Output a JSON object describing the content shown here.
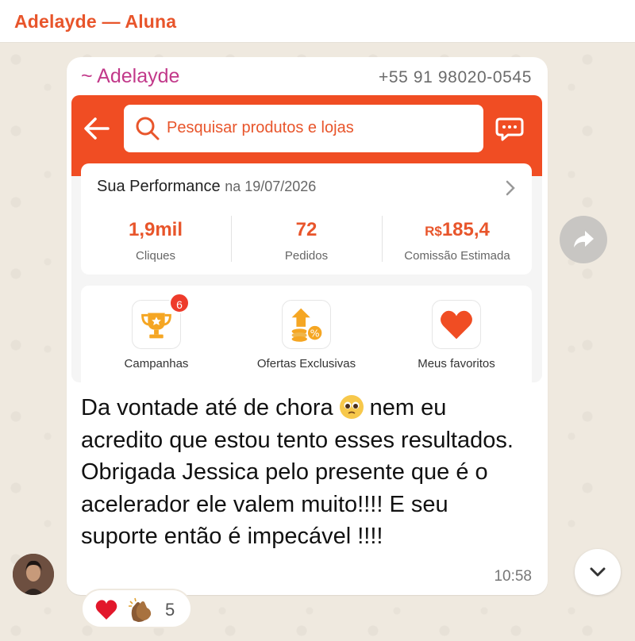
{
  "header": {
    "title": "Adelayde — Aluna"
  },
  "message": {
    "sender_name": "~ Adelayde",
    "sender_phone": "+55 91 98020-0545",
    "text_line1a": "Da vontade até de chora",
    "text_line1b": "nem eu",
    "text_rest": "acredito que estou tento esses resultados. Obrigada Jessica pelo presente que é o acelerador ele valem muito!!!! E seu suporte então é impecável !!!!",
    "time": "10:58",
    "inline_emoji": "pleading-face-icon",
    "reactions": {
      "emojis": [
        "red-heart-icon",
        "clapping-hands-icon"
      ],
      "count": "5"
    }
  },
  "screenshot": {
    "search_placeholder": "Pesquisar produtos e lojas",
    "performance": {
      "title": "Sua Performance",
      "date": "na 19/07/2026",
      "stats": [
        {
          "value": "1,9mil",
          "label": "Cliques"
        },
        {
          "value": "72",
          "label": "Pedidos"
        },
        {
          "currency": "R$",
          "value": "185,4",
          "label": "Comissão Estimada"
        }
      ]
    },
    "shortcuts": [
      {
        "label": "Campanhas",
        "icon": "trophy-icon",
        "badge": "6"
      },
      {
        "label": "Ofertas Exclusivas",
        "icon": "coins-percent-icon"
      },
      {
        "label": "Meus favoritos",
        "icon": "heart-icon"
      }
    ]
  },
  "colors": {
    "brand": "#f04d23",
    "accent_text": "#e8552b",
    "sender": "#c2398a"
  }
}
